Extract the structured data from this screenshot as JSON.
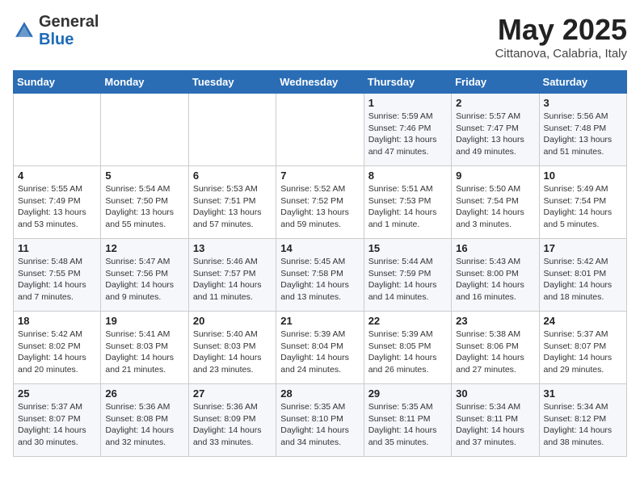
{
  "header": {
    "logo_general": "General",
    "logo_blue": "Blue",
    "month": "May 2025",
    "location": "Cittanova, Calabria, Italy"
  },
  "days_of_week": [
    "Sunday",
    "Monday",
    "Tuesday",
    "Wednesday",
    "Thursday",
    "Friday",
    "Saturday"
  ],
  "weeks": [
    [
      {
        "day": "",
        "info": ""
      },
      {
        "day": "",
        "info": ""
      },
      {
        "day": "",
        "info": ""
      },
      {
        "day": "",
        "info": ""
      },
      {
        "day": "1",
        "info": "Sunrise: 5:59 AM\nSunset: 7:46 PM\nDaylight: 13 hours and 47 minutes."
      },
      {
        "day": "2",
        "info": "Sunrise: 5:57 AM\nSunset: 7:47 PM\nDaylight: 13 hours and 49 minutes."
      },
      {
        "day": "3",
        "info": "Sunrise: 5:56 AM\nSunset: 7:48 PM\nDaylight: 13 hours and 51 minutes."
      }
    ],
    [
      {
        "day": "4",
        "info": "Sunrise: 5:55 AM\nSunset: 7:49 PM\nDaylight: 13 hours and 53 minutes."
      },
      {
        "day": "5",
        "info": "Sunrise: 5:54 AM\nSunset: 7:50 PM\nDaylight: 13 hours and 55 minutes."
      },
      {
        "day": "6",
        "info": "Sunrise: 5:53 AM\nSunset: 7:51 PM\nDaylight: 13 hours and 57 minutes."
      },
      {
        "day": "7",
        "info": "Sunrise: 5:52 AM\nSunset: 7:52 PM\nDaylight: 13 hours and 59 minutes."
      },
      {
        "day": "8",
        "info": "Sunrise: 5:51 AM\nSunset: 7:53 PM\nDaylight: 14 hours and 1 minute."
      },
      {
        "day": "9",
        "info": "Sunrise: 5:50 AM\nSunset: 7:54 PM\nDaylight: 14 hours and 3 minutes."
      },
      {
        "day": "10",
        "info": "Sunrise: 5:49 AM\nSunset: 7:54 PM\nDaylight: 14 hours and 5 minutes."
      }
    ],
    [
      {
        "day": "11",
        "info": "Sunrise: 5:48 AM\nSunset: 7:55 PM\nDaylight: 14 hours and 7 minutes."
      },
      {
        "day": "12",
        "info": "Sunrise: 5:47 AM\nSunset: 7:56 PM\nDaylight: 14 hours and 9 minutes."
      },
      {
        "day": "13",
        "info": "Sunrise: 5:46 AM\nSunset: 7:57 PM\nDaylight: 14 hours and 11 minutes."
      },
      {
        "day": "14",
        "info": "Sunrise: 5:45 AM\nSunset: 7:58 PM\nDaylight: 14 hours and 13 minutes."
      },
      {
        "day": "15",
        "info": "Sunrise: 5:44 AM\nSunset: 7:59 PM\nDaylight: 14 hours and 14 minutes."
      },
      {
        "day": "16",
        "info": "Sunrise: 5:43 AM\nSunset: 8:00 PM\nDaylight: 14 hours and 16 minutes."
      },
      {
        "day": "17",
        "info": "Sunrise: 5:42 AM\nSunset: 8:01 PM\nDaylight: 14 hours and 18 minutes."
      }
    ],
    [
      {
        "day": "18",
        "info": "Sunrise: 5:42 AM\nSunset: 8:02 PM\nDaylight: 14 hours and 20 minutes."
      },
      {
        "day": "19",
        "info": "Sunrise: 5:41 AM\nSunset: 8:03 PM\nDaylight: 14 hours and 21 minutes."
      },
      {
        "day": "20",
        "info": "Sunrise: 5:40 AM\nSunset: 8:03 PM\nDaylight: 14 hours and 23 minutes."
      },
      {
        "day": "21",
        "info": "Sunrise: 5:39 AM\nSunset: 8:04 PM\nDaylight: 14 hours and 24 minutes."
      },
      {
        "day": "22",
        "info": "Sunrise: 5:39 AM\nSunset: 8:05 PM\nDaylight: 14 hours and 26 minutes."
      },
      {
        "day": "23",
        "info": "Sunrise: 5:38 AM\nSunset: 8:06 PM\nDaylight: 14 hours and 27 minutes."
      },
      {
        "day": "24",
        "info": "Sunrise: 5:37 AM\nSunset: 8:07 PM\nDaylight: 14 hours and 29 minutes."
      }
    ],
    [
      {
        "day": "25",
        "info": "Sunrise: 5:37 AM\nSunset: 8:07 PM\nDaylight: 14 hours and 30 minutes."
      },
      {
        "day": "26",
        "info": "Sunrise: 5:36 AM\nSunset: 8:08 PM\nDaylight: 14 hours and 32 minutes."
      },
      {
        "day": "27",
        "info": "Sunrise: 5:36 AM\nSunset: 8:09 PM\nDaylight: 14 hours and 33 minutes."
      },
      {
        "day": "28",
        "info": "Sunrise: 5:35 AM\nSunset: 8:10 PM\nDaylight: 14 hours and 34 minutes."
      },
      {
        "day": "29",
        "info": "Sunrise: 5:35 AM\nSunset: 8:11 PM\nDaylight: 14 hours and 35 minutes."
      },
      {
        "day": "30",
        "info": "Sunrise: 5:34 AM\nSunset: 8:11 PM\nDaylight: 14 hours and 37 minutes."
      },
      {
        "day": "31",
        "info": "Sunrise: 5:34 AM\nSunset: 8:12 PM\nDaylight: 14 hours and 38 minutes."
      }
    ]
  ]
}
